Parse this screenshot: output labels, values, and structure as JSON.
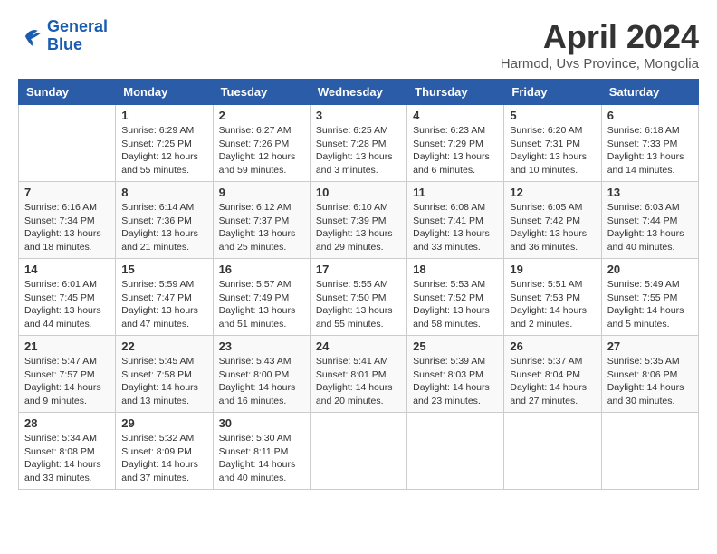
{
  "logo": {
    "line1": "General",
    "line2": "Blue"
  },
  "title": "April 2024",
  "location": "Harmod, Uvs Province, Mongolia",
  "days_of_week": [
    "Sunday",
    "Monday",
    "Tuesday",
    "Wednesday",
    "Thursday",
    "Friday",
    "Saturday"
  ],
  "weeks": [
    [
      {
        "num": "",
        "sunrise": "",
        "sunset": "",
        "daylight": ""
      },
      {
        "num": "1",
        "sunrise": "Sunrise: 6:29 AM",
        "sunset": "Sunset: 7:25 PM",
        "daylight": "Daylight: 12 hours and 55 minutes."
      },
      {
        "num": "2",
        "sunrise": "Sunrise: 6:27 AM",
        "sunset": "Sunset: 7:26 PM",
        "daylight": "Daylight: 12 hours and 59 minutes."
      },
      {
        "num": "3",
        "sunrise": "Sunrise: 6:25 AM",
        "sunset": "Sunset: 7:28 PM",
        "daylight": "Daylight: 13 hours and 3 minutes."
      },
      {
        "num": "4",
        "sunrise": "Sunrise: 6:23 AM",
        "sunset": "Sunset: 7:29 PM",
        "daylight": "Daylight: 13 hours and 6 minutes."
      },
      {
        "num": "5",
        "sunrise": "Sunrise: 6:20 AM",
        "sunset": "Sunset: 7:31 PM",
        "daylight": "Daylight: 13 hours and 10 minutes."
      },
      {
        "num": "6",
        "sunrise": "Sunrise: 6:18 AM",
        "sunset": "Sunset: 7:33 PM",
        "daylight": "Daylight: 13 hours and 14 minutes."
      }
    ],
    [
      {
        "num": "7",
        "sunrise": "Sunrise: 6:16 AM",
        "sunset": "Sunset: 7:34 PM",
        "daylight": "Daylight: 13 hours and 18 minutes."
      },
      {
        "num": "8",
        "sunrise": "Sunrise: 6:14 AM",
        "sunset": "Sunset: 7:36 PM",
        "daylight": "Daylight: 13 hours and 21 minutes."
      },
      {
        "num": "9",
        "sunrise": "Sunrise: 6:12 AM",
        "sunset": "Sunset: 7:37 PM",
        "daylight": "Daylight: 13 hours and 25 minutes."
      },
      {
        "num": "10",
        "sunrise": "Sunrise: 6:10 AM",
        "sunset": "Sunset: 7:39 PM",
        "daylight": "Daylight: 13 hours and 29 minutes."
      },
      {
        "num": "11",
        "sunrise": "Sunrise: 6:08 AM",
        "sunset": "Sunset: 7:41 PM",
        "daylight": "Daylight: 13 hours and 33 minutes."
      },
      {
        "num": "12",
        "sunrise": "Sunrise: 6:05 AM",
        "sunset": "Sunset: 7:42 PM",
        "daylight": "Daylight: 13 hours and 36 minutes."
      },
      {
        "num": "13",
        "sunrise": "Sunrise: 6:03 AM",
        "sunset": "Sunset: 7:44 PM",
        "daylight": "Daylight: 13 hours and 40 minutes."
      }
    ],
    [
      {
        "num": "14",
        "sunrise": "Sunrise: 6:01 AM",
        "sunset": "Sunset: 7:45 PM",
        "daylight": "Daylight: 13 hours and 44 minutes."
      },
      {
        "num": "15",
        "sunrise": "Sunrise: 5:59 AM",
        "sunset": "Sunset: 7:47 PM",
        "daylight": "Daylight: 13 hours and 47 minutes."
      },
      {
        "num": "16",
        "sunrise": "Sunrise: 5:57 AM",
        "sunset": "Sunset: 7:49 PM",
        "daylight": "Daylight: 13 hours and 51 minutes."
      },
      {
        "num": "17",
        "sunrise": "Sunrise: 5:55 AM",
        "sunset": "Sunset: 7:50 PM",
        "daylight": "Daylight: 13 hours and 55 minutes."
      },
      {
        "num": "18",
        "sunrise": "Sunrise: 5:53 AM",
        "sunset": "Sunset: 7:52 PM",
        "daylight": "Daylight: 13 hours and 58 minutes."
      },
      {
        "num": "19",
        "sunrise": "Sunrise: 5:51 AM",
        "sunset": "Sunset: 7:53 PM",
        "daylight": "Daylight: 14 hours and 2 minutes."
      },
      {
        "num": "20",
        "sunrise": "Sunrise: 5:49 AM",
        "sunset": "Sunset: 7:55 PM",
        "daylight": "Daylight: 14 hours and 5 minutes."
      }
    ],
    [
      {
        "num": "21",
        "sunrise": "Sunrise: 5:47 AM",
        "sunset": "Sunset: 7:57 PM",
        "daylight": "Daylight: 14 hours and 9 minutes."
      },
      {
        "num": "22",
        "sunrise": "Sunrise: 5:45 AM",
        "sunset": "Sunset: 7:58 PM",
        "daylight": "Daylight: 14 hours and 13 minutes."
      },
      {
        "num": "23",
        "sunrise": "Sunrise: 5:43 AM",
        "sunset": "Sunset: 8:00 PM",
        "daylight": "Daylight: 14 hours and 16 minutes."
      },
      {
        "num": "24",
        "sunrise": "Sunrise: 5:41 AM",
        "sunset": "Sunset: 8:01 PM",
        "daylight": "Daylight: 14 hours and 20 minutes."
      },
      {
        "num": "25",
        "sunrise": "Sunrise: 5:39 AM",
        "sunset": "Sunset: 8:03 PM",
        "daylight": "Daylight: 14 hours and 23 minutes."
      },
      {
        "num": "26",
        "sunrise": "Sunrise: 5:37 AM",
        "sunset": "Sunset: 8:04 PM",
        "daylight": "Daylight: 14 hours and 27 minutes."
      },
      {
        "num": "27",
        "sunrise": "Sunrise: 5:35 AM",
        "sunset": "Sunset: 8:06 PM",
        "daylight": "Daylight: 14 hours and 30 minutes."
      }
    ],
    [
      {
        "num": "28",
        "sunrise": "Sunrise: 5:34 AM",
        "sunset": "Sunset: 8:08 PM",
        "daylight": "Daylight: 14 hours and 33 minutes."
      },
      {
        "num": "29",
        "sunrise": "Sunrise: 5:32 AM",
        "sunset": "Sunset: 8:09 PM",
        "daylight": "Daylight: 14 hours and 37 minutes."
      },
      {
        "num": "30",
        "sunrise": "Sunrise: 5:30 AM",
        "sunset": "Sunset: 8:11 PM",
        "daylight": "Daylight: 14 hours and 40 minutes."
      },
      {
        "num": "",
        "sunrise": "",
        "sunset": "",
        "daylight": ""
      },
      {
        "num": "",
        "sunrise": "",
        "sunset": "",
        "daylight": ""
      },
      {
        "num": "",
        "sunrise": "",
        "sunset": "",
        "daylight": ""
      },
      {
        "num": "",
        "sunrise": "",
        "sunset": "",
        "daylight": ""
      }
    ]
  ]
}
